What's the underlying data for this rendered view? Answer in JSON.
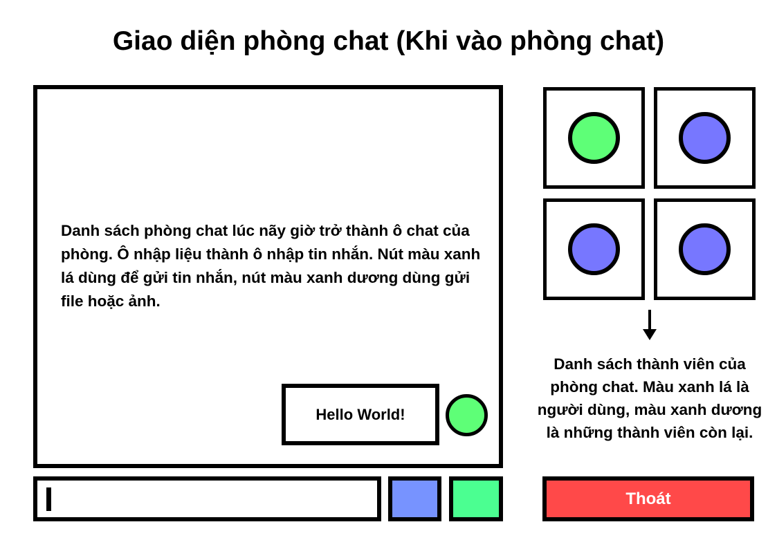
{
  "title": "Giao diện phòng chat (Khi vào phòng chat)",
  "chat_area": {
    "description": "Danh sách phòng chat lúc nãy giờ trở thành ô chat của phòng. Ô nhập liệu thành ô nhập tin nhắn. Nút màu xanh lá dùng để gửi tin nhắn, nút màu xanh dương dùng gửi file hoặc ảnh.",
    "message_text": "Hello World!",
    "sender_color": "#5eff77"
  },
  "composer": {
    "input_value": "",
    "file_button_color": "#7793ff",
    "send_button_color": "#4bff91"
  },
  "members": {
    "self_color": "#5eff77",
    "other_color": "#7777ff",
    "tiles": [
      {
        "role": "self",
        "color": "#5eff77"
      },
      {
        "role": "other",
        "color": "#7777ff"
      },
      {
        "role": "other",
        "color": "#7777ff"
      },
      {
        "role": "other",
        "color": "#7777ff"
      }
    ],
    "description": "Danh sách thành viên của phòng chat. Màu xanh lá là người dùng, màu xanh dương là những thành viên còn lại."
  },
  "exit_button": {
    "label": "Thoát",
    "color": "#ff4949"
  }
}
